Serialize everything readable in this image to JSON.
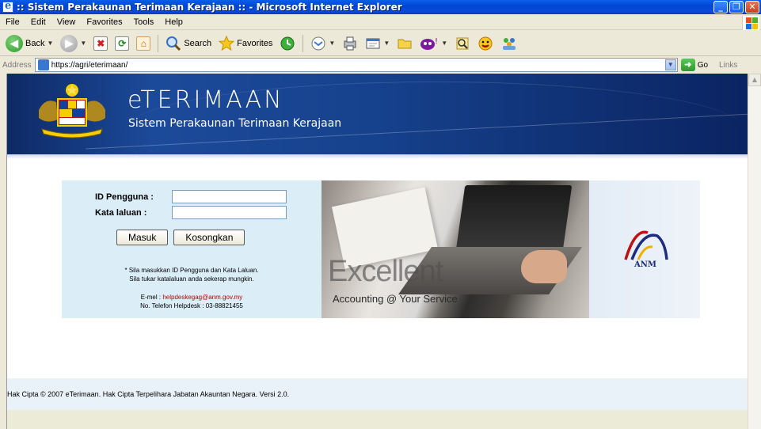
{
  "window": {
    "title": ":: Sistem Perakaunan Terimaan Kerajaan :: - Microsoft Internet Explorer",
    "minimize": "_",
    "restore": "❐",
    "close": "✕"
  },
  "menu": [
    "File",
    "Edit",
    "View",
    "Favorites",
    "Tools",
    "Help"
  ],
  "toolbar": {
    "back_label": "Back",
    "search_label": "Search",
    "favorites_label": "Favorites"
  },
  "address": {
    "label": "Address",
    "url": "https://agri/eterimaan/",
    "go_label": "Go",
    "links_label": "Links"
  },
  "banner": {
    "brand": "eTERIMAAN",
    "tagline": "Sistem Perakaunan Terimaan Kerajaan"
  },
  "login": {
    "user_label": "ID Pengguna :",
    "password_label": "Kata laluan :",
    "submit_label": "Masuk",
    "clear_label": "Kosongkan",
    "note_line1": "* Sila masukkan ID Pengguna dan Kata Laluan.",
    "note_line2": "Sila tukar katalaluan anda sekerap mungkin.",
    "email_prefix": "E-mel : ",
    "email": "helpdeskegag@anm.gov.my",
    "phone": "No. Telefon Helpdesk : 03-88821455"
  },
  "promo": {
    "headline": "Excellent",
    "subline": "Accounting @ Your Service"
  },
  "logo": {
    "anm_text": "ANM"
  },
  "footer": {
    "text": "Hak Cipta © 2007 eTerimaan. Hak Cipta Terpelihara Jabatan Akauntan Negara. Versi 2.0."
  },
  "colors": {
    "titlebar": "#0046d5",
    "banner": "#16418c",
    "login_panel": "#dbeef8",
    "email_link": "#c00000"
  }
}
